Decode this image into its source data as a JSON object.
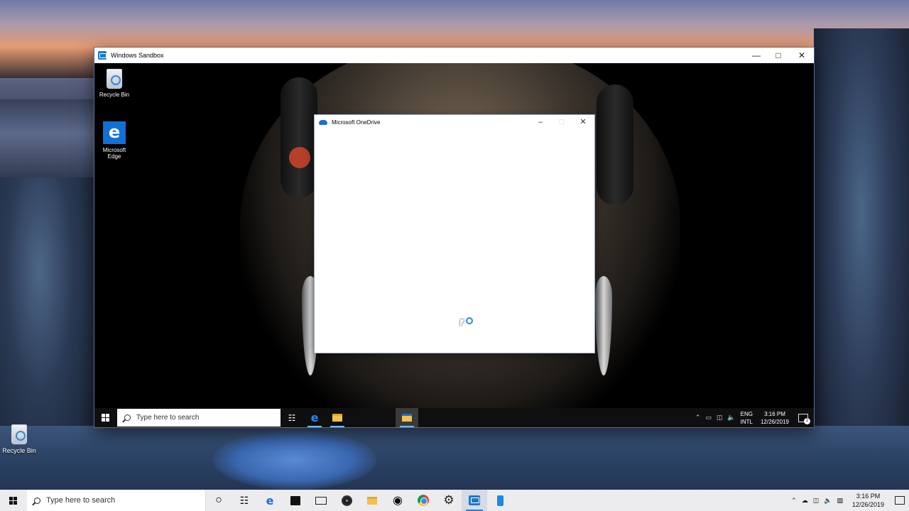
{
  "host": {
    "desktop_icons": [
      {
        "label": "Recycle Bin",
        "icon": "recycle-bin-icon"
      }
    ],
    "taskbar": {
      "search_placeholder": "Type here to search",
      "apps": [
        {
          "name": "cortana",
          "icon": "cortana-icon"
        },
        {
          "name": "task-view",
          "icon": "task-view-icon"
        },
        {
          "name": "edge",
          "icon": "edge-icon"
        },
        {
          "name": "store",
          "icon": "store-icon"
        },
        {
          "name": "mail",
          "icon": "mail-icon"
        },
        {
          "name": "media",
          "icon": "media-disc-icon"
        },
        {
          "name": "file-explorer",
          "icon": "folder-icon"
        },
        {
          "name": "recorder",
          "icon": "target-icon"
        },
        {
          "name": "chrome",
          "icon": "chrome-icon"
        },
        {
          "name": "settings",
          "icon": "gear-icon"
        },
        {
          "name": "windows-sandbox",
          "icon": "sandbox-icon",
          "active": true
        },
        {
          "name": "phone",
          "icon": "phone-icon"
        }
      ],
      "time": "3:16 PM",
      "date": "12/26/2019"
    }
  },
  "sandbox": {
    "title": "Windows Sandbox",
    "desktop_icons": [
      {
        "label": "Recycle Bin",
        "icon": "recycle-bin-icon"
      },
      {
        "label": "Microsoft Edge",
        "icon": "edge-icon"
      }
    ],
    "onedrive_dialog": {
      "title": "Microsoft OneDrive"
    },
    "taskbar": {
      "search_placeholder": "Type here to search",
      "language_line1": "ENG",
      "language_line2": "INTL",
      "time": "3:16 PM",
      "date": "12/26/2019",
      "notification_count": "2"
    }
  },
  "colors": {
    "accent": "#1e78c8",
    "taskbar_dark": "#0f0f0f",
    "taskbar_light": "#ececee"
  }
}
